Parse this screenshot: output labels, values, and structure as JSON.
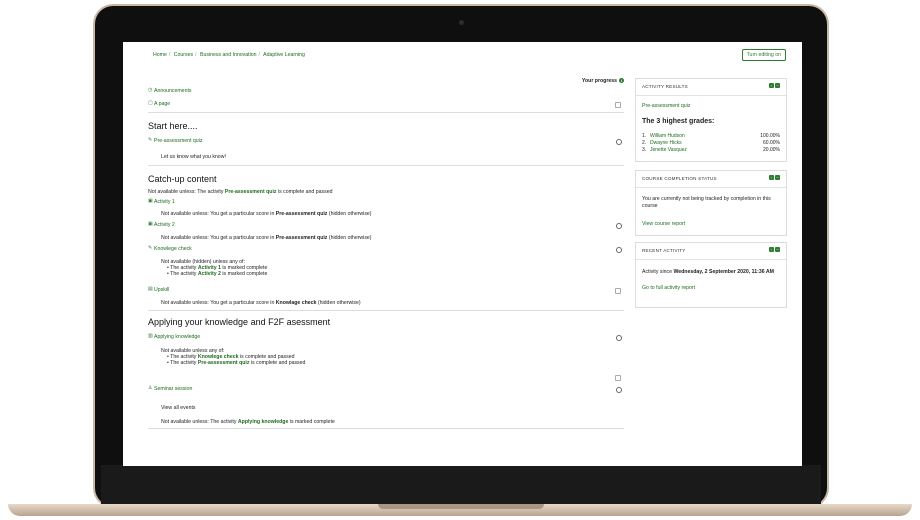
{
  "breadcrumb": [
    "Home",
    "Courses",
    "Business and Innovation",
    "Adaptive Learning"
  ],
  "edit_button": "Turn editing on",
  "progress_label": "Your progress",
  "activities_top": [
    {
      "icon": "announcement-icon",
      "label": "Announcements"
    },
    {
      "icon": "page-icon",
      "label": "A page"
    }
  ],
  "sections": {
    "start": {
      "title": "Start here....",
      "quiz": "Pre-assessment quiz",
      "desc": "Let us know what you know!"
    },
    "catchup": {
      "title": "Catch-up content",
      "restriction_prefix": "Not available unless: The activity",
      "restriction_activity": "Pre-assessment quiz",
      "restriction_suffix": "is complete and passed",
      "activity1": "Activity 1",
      "activity1_note_prefix": "Not available unless: You get a particular score in",
      "activity1_note_activity": "Pre-assessment quiz",
      "activity1_note_suffix": "(hidden otherwise)",
      "activity2": "Activity 2",
      "activity2_note_prefix": "Not available unless: You get a particular score in",
      "activity2_note_activity": "Pre-assessment quiz",
      "activity2_note_suffix": "(hidden otherwise)",
      "knowledge_check": "Knowlege check",
      "kc_note": "Not available (hidden) unless any of:",
      "kc_conditions": [
        {
          "prefix": "The activity",
          "activity": "Activity 1",
          "suffix": "is marked complete"
        },
        {
          "prefix": "The activity",
          "activity": "Activity 2",
          "suffix": "is marked complete"
        }
      ],
      "upskill": "Upskill",
      "upskill_note_prefix": "Not available unless: You get a particular score in",
      "upskill_note_activity": "Knowlage check",
      "upskill_note_suffix": "(hidden otherwise)"
    },
    "applying": {
      "title": "Applying your knowledge and F2F asessment",
      "applying_activity": "Applying knowledge",
      "apply_note": "Not available unless any of:",
      "apply_conditions": [
        {
          "prefix": "The activity",
          "activity": "Knowlege check",
          "suffix": "is complete and passed"
        },
        {
          "prefix": "The activity",
          "activity": "Pre-assessment quiz",
          "suffix": "is complete and passed"
        }
      ],
      "seminar": "Seminar session",
      "view_events": "View all events",
      "seminar_note_prefix": "Not available unless: The activity",
      "seminar_note_activity": "Applying knowledge",
      "seminar_note_suffix": "is marked complete"
    }
  },
  "blocks": {
    "results": {
      "title": "ACTIVITY RESULTS",
      "quiz_link": "Pre-assessment quiz",
      "heading": "The 3 highest grades:",
      "grades": [
        {
          "rank": "1.",
          "name": "William Hudson",
          "score": "100.00%"
        },
        {
          "rank": "2.",
          "name": "Dwayne Hicks",
          "score": "60.00%"
        },
        {
          "rank": "3.",
          "name": "Jenette Vasquez",
          "score": "20.00%"
        }
      ]
    },
    "completion": {
      "title": "COURSE COMPLETION STATUS",
      "text": "You are currently not being tracked by completion in this course",
      "link": "View course report"
    },
    "recent": {
      "title": "RECENT ACTIVITY",
      "since_prefix": "Activity since",
      "since_date": "Wednesday, 2 September 2020, 11:36 AM",
      "link": "Go to full activity report"
    }
  },
  "colors": {
    "accent": "#2e7d32",
    "link": "#1e6b1f"
  }
}
